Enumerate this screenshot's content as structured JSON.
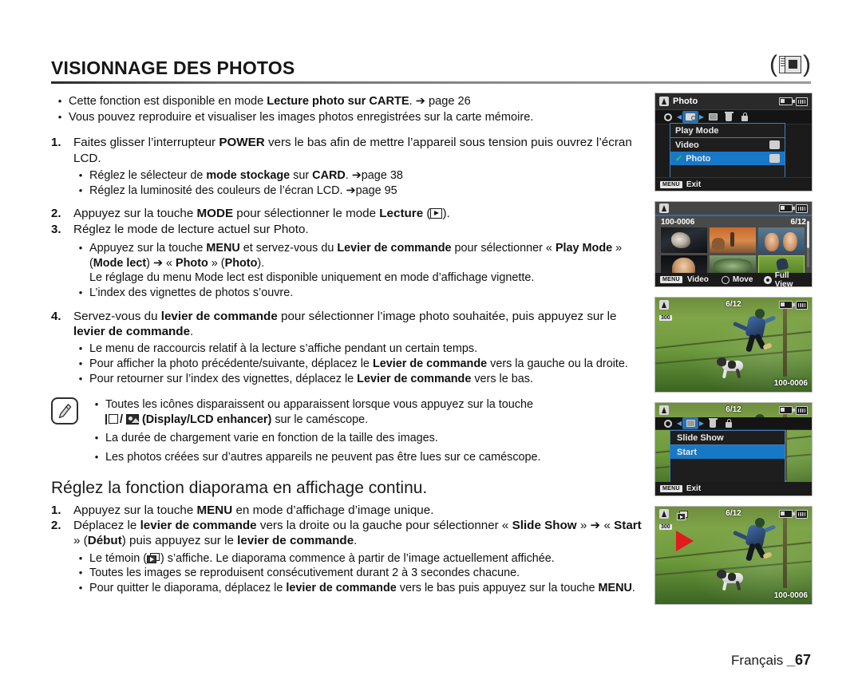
{
  "header": {
    "title": "VISIONNAGE DES PHOTOS",
    "icon": "memory-card-photo-icon"
  },
  "intro": [
    {
      "parts": [
        {
          "t": "Cette fonction est disponible en mode ",
          "b": false
        },
        {
          "t": "Lecture photo sur CARTE",
          "b": true
        },
        {
          "t": ". ➔ page 26",
          "b": false
        }
      ]
    },
    {
      "parts": [
        {
          "t": "Vous pouvez reproduire et visualiser les images photos enregistrées sur la carte mémoire.",
          "b": false
        }
      ]
    }
  ],
  "steps": {
    "n1": "1.",
    "n2": "2.",
    "n3": "3.",
    "n4": "4.",
    "step1_a": "Faites glisser l’interrupteur ",
    "step1_power": "POWER",
    "step1_b": " vers le bas afin de mettre l’appareil sous tension puis ouvrez l’écran LCD.",
    "step1_sub1_a": "Réglez le sélecteur de ",
    "step1_sub1_bold1": "mode stockage",
    "step1_sub1_b": " sur ",
    "step1_sub1_bold2": "CARD",
    "step1_sub1_c": ". ➔page 38",
    "step1_sub2": "Réglez la luminosité des couleurs de l’écran LCD. ➔page 95",
    "step2_a": "Appuyez sur la touche ",
    "step2_menu": "MODE",
    "step2_b": " pour sélectionner le mode ",
    "step2_bold": "Lecture",
    "step2_c": " (",
    "step2_d": ").",
    "step3": "Réglez le mode de lecture actuel sur Photo.",
    "step3_sub1_a": "Appuyez sur la touche ",
    "step3_sub1_menu": "MENU",
    "step3_sub1_b": " et servez-vous du ",
    "step3_sub1_bold": "Levier de commande",
    "step3_sub1_c": " pour sélectionner « ",
    "step3_sub1_pm": "Play Mode",
    "step3_sub1_d": " » (",
    "step3_sub1_ml": "Mode lect",
    "step3_sub1_e": ") ➔ « ",
    "step3_sub1_photo1": "Photo",
    "step3_sub1_f": " » (",
    "step3_sub1_photo2": "Photo",
    "step3_sub1_g": ").",
    "step3_sub1_line2": "Le réglage du menu Mode lect est disponible uniquement en mode d’affichage vignette.",
    "step3_sub2": "L’index des vignettes de photos s’ouvre.",
    "step4_a": "Servez-vous du ",
    "step4_bold1": "levier de commande",
    "step4_b": " pour sélectionner l’image photo souhaitée, puis appuyez sur le ",
    "step4_bold2": "levier de commande",
    "step4_c": ".",
    "step4_sub1": "Le menu de raccourcis relatif à la lecture s’affiche pendant un certain temps.",
    "step4_sub2_a": "Pour afficher la photo précédente/suivante, déplacez le ",
    "step4_sub2_bold": "Levier de commande",
    "step4_sub2_b": " vers la gauche ou la droite.",
    "step4_sub3_a": "Pour retourner sur l’index des vignettes, déplacez le ",
    "step4_sub3_bold": "Levier de commande",
    "step4_sub3_b": " vers le bas."
  },
  "note": {
    "icon": "note-pencil-icon",
    "item1_a": "Toutes les icônes disparaissent ou apparaissent lorsque vous appuyez sur la touche ",
    "item1_slash": "/",
    "item1_bold": " (Display/LCD enhancer)",
    "item1_b": " sur le caméscope.",
    "item2": "La durée de chargement varie en fonction de la taille des images.",
    "item3": "Les photos créées sur d’autres appareils ne peuvent pas être lues sur ce caméscope."
  },
  "section2": {
    "heading": "Réglez la fonction diaporama en affichage continu.",
    "n1": "1.",
    "n2": "2.",
    "s1_a": "Appuyez sur la touche ",
    "s1_menu": "MENU",
    "s1_b": " en mode d’affichage d’image unique.",
    "s2_a": "Déplacez le ",
    "s2_bold1": "levier de commande",
    "s2_b": " vers la droite ou la gauche pour sélectionner « ",
    "s2_slide": "Slide Show",
    "s2_c": " » ➔ « ",
    "s2_start": "Start",
    "s2_d": " » (",
    "s2_debut": "Début",
    "s2_e": ") puis appuyez sur le ",
    "s2_bold2": "levier de commande",
    "s2_f": ".",
    "sub1_a": "Le témoin (",
    "sub1_b": ") s’affiche. Le diaporama commence à partir de l’image actuellement affichée.",
    "sub2": "Toutes les images se reproduisent consécutivement durant 2 à 3 secondes chacune.",
    "sub3_a": "Pour quitter le diaporama, déplacez le ",
    "sub3_bold": "levier de commande",
    "sub3_b": " vers le bas puis appuyez sur la touche ",
    "sub3_menu": "MENU",
    "sub3_c": "."
  },
  "screens": {
    "screen1": {
      "title": "Photo",
      "tabs": [
        "gear-icon",
        "play-mode-icon",
        "slideshow-icon",
        "trash-icon",
        "lock-icon"
      ],
      "menu_header": "Play Mode",
      "items": [
        {
          "label": "Video",
          "selected": false,
          "checked": false,
          "icon": "video-icon"
        },
        {
          "label": "Photo",
          "selected": true,
          "checked": true,
          "icon": "photo-icon"
        }
      ],
      "bottom_button": "MENU",
      "bottom_label": "Exit"
    },
    "screen2": {
      "file_no": "100-0006",
      "counter": "6/12",
      "bottom_button": "MENU",
      "bottom_label_1": "Video",
      "bottom_label_2": "Move",
      "bottom_label_3": "Full View"
    },
    "screen3": {
      "counter": "6/12",
      "resolution_badge": "300",
      "file_no": "100-0006"
    },
    "screen4": {
      "counter": "6/12",
      "menu_header": "Slide Show",
      "menu_item": "Start",
      "bottom_button": "MENU",
      "bottom_label": "Exit"
    },
    "screen5": {
      "counter": "6/12",
      "resolution_badge": "300",
      "file_no": "100-0006"
    }
  },
  "footer": {
    "language": "Français ",
    "page": "_67"
  }
}
